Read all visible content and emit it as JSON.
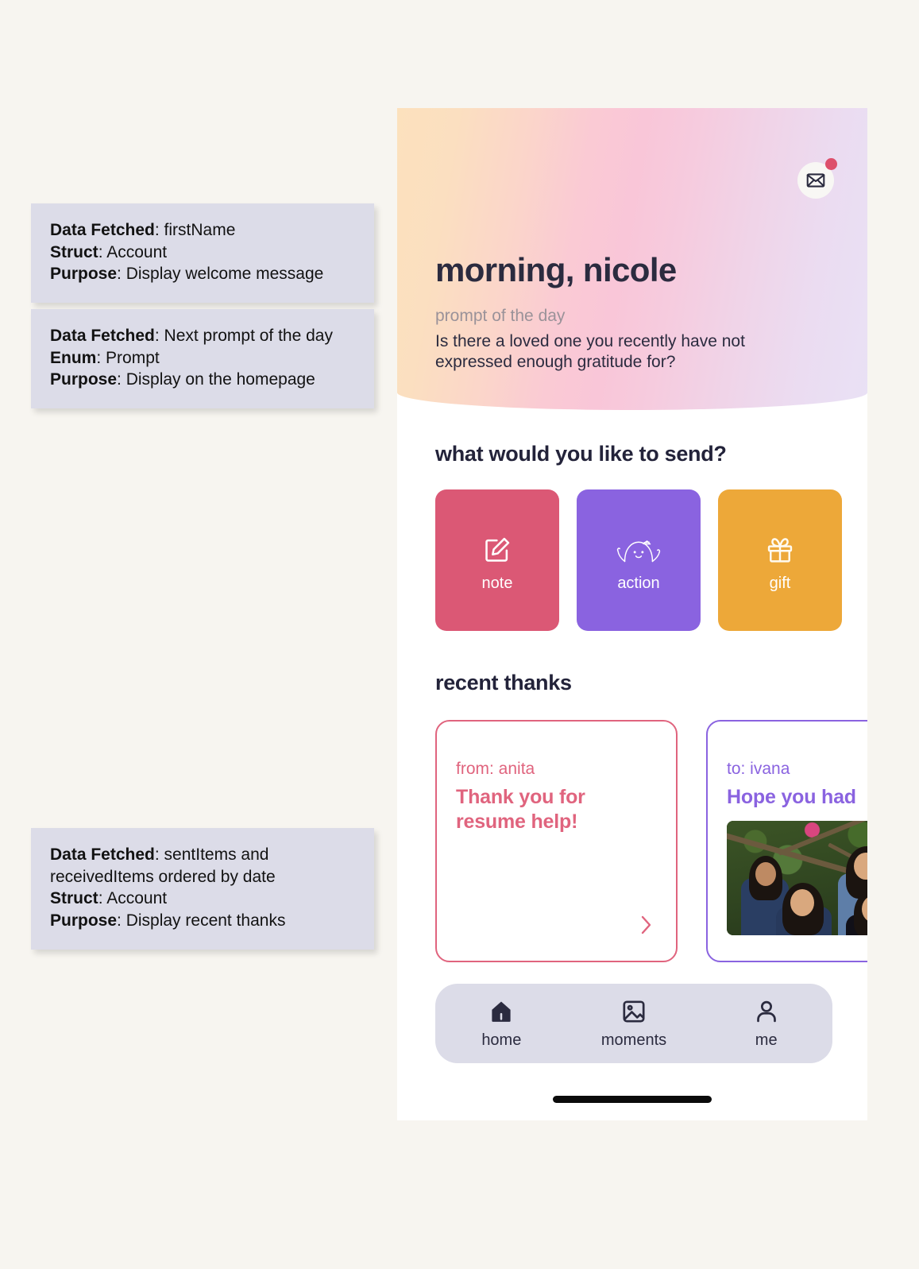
{
  "background_color": "#F7F5F0",
  "annotations": [
    {
      "id": "anno-1",
      "rows": [
        {
          "label": "Data Fetched",
          "value": "firstName"
        },
        {
          "label": "Struct",
          "value": "Account"
        },
        {
          "label": "Purpose",
          "value": "Display welcome message"
        }
      ]
    },
    {
      "id": "anno-2",
      "rows": [
        {
          "label": "Data Fetched",
          "value": "Next prompt of the day"
        },
        {
          "label": "Enum",
          "value": "Prompt"
        },
        {
          "label": "Purpose",
          "value": "Display on the homepage"
        }
      ]
    },
    {
      "id": "anno-3",
      "rows": [
        {
          "label": "Data Fetched",
          "value": "sentItems and receivedItems ordered by date"
        },
        {
          "label": "Struct",
          "value": "Account"
        },
        {
          "label": "Purpose",
          "value": "Display recent thanks"
        }
      ]
    }
  ],
  "phone": {
    "header": {
      "mail_icon": "envelope-icon",
      "has_unread_badge": true,
      "badge_color": "#DD4F6B",
      "greeting": "morning, nicole",
      "prompt_label": "prompt of the day",
      "prompt_text": "Is there a loved one you recently have not expressed enough gratitude for?",
      "gradient_start": "#FCE1BD",
      "gradient_mid": "#F9C6D8",
      "gradient_end": "#E9E1F5"
    },
    "send_section": {
      "title": "what would you like to send?",
      "cards": [
        {
          "label": "note",
          "icon": "note-pencil-icon",
          "color": "#DB5875"
        },
        {
          "label": "action",
          "icon": "happy-blob-icon",
          "color": "#8A63E0"
        },
        {
          "label": "gift",
          "icon": "gift-icon",
          "color": "#EDA839"
        }
      ]
    },
    "thanks_section": {
      "title": "recent thanks",
      "cards": [
        {
          "recipient": "from: anita",
          "message": "Thank you for resume help!",
          "accent": "#E0647E",
          "has_photo": false,
          "has_arrow": true,
          "arrow_icon": "chevron-right-icon"
        },
        {
          "recipient": "to: ivana",
          "message": "Hope you had",
          "accent": "#8A63E0",
          "has_photo": true,
          "has_arrow": false,
          "photo_alt": "four friends smiling in front of a flowering tree"
        }
      ]
    },
    "bottom_nav": {
      "background": "#DCDCE8",
      "items": [
        {
          "label": "home",
          "icon": "home-icon",
          "active": true
        },
        {
          "label": "moments",
          "icon": "image-icon",
          "active": false
        },
        {
          "label": "me",
          "icon": "person-icon",
          "active": false
        }
      ]
    }
  }
}
